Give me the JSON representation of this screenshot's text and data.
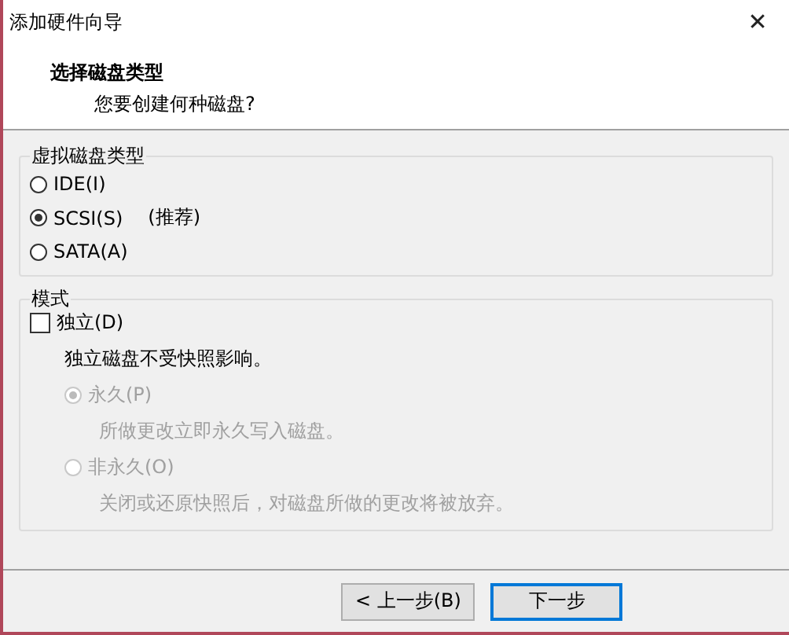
{
  "window": {
    "title": "添加硬件向导",
    "close": "✕"
  },
  "header": {
    "title": "选择磁盘类型",
    "subtitle": "您要创建何种磁盘?"
  },
  "disk_type": {
    "legend": "虚拟磁盘类型",
    "options": [
      {
        "label": "IDE(I)",
        "selected": false
      },
      {
        "label": "SCSI(S)",
        "note": "(推荐)",
        "selected": true
      },
      {
        "label": "SATA(A)",
        "selected": false
      }
    ]
  },
  "mode": {
    "legend": "模式",
    "independent": {
      "label": "独立(D)",
      "checked": false,
      "description": "独立磁盘不受快照影响。"
    },
    "options": [
      {
        "label": "永久(P)",
        "description": "所做更改立即永久写入磁盘。",
        "selected": true,
        "disabled": true
      },
      {
        "label": "非永久(O)",
        "description": "关闭或还原快照后，对磁盘所做的更改将被放弃。",
        "selected": false,
        "disabled": true
      }
    ]
  },
  "buttons": [
    {
      "label": "< 上一步(B)",
      "default": false
    },
    {
      "label": "下一步",
      "default": true
    }
  ]
}
